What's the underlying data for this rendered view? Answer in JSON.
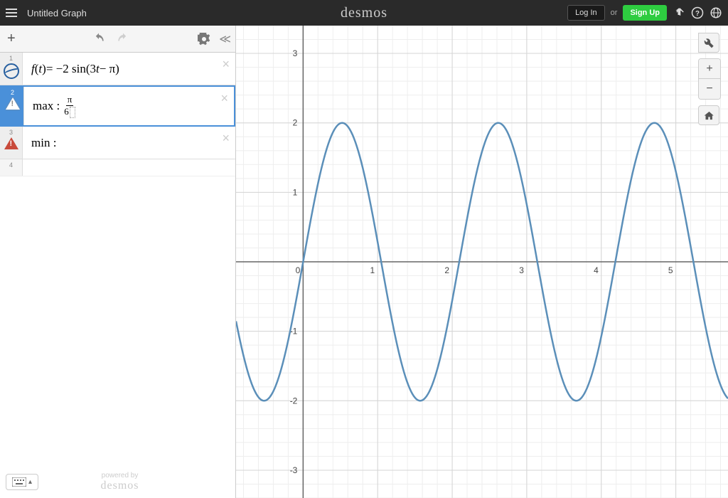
{
  "header": {
    "title": "Untitled Graph",
    "logo": "desmos",
    "login": "Log In",
    "or": "or",
    "signup": "Sign Up"
  },
  "expressions": {
    "row1": {
      "num": "1",
      "formula_prefix": "f",
      "formula_var": "t",
      "formula_eq": " = −2 sin(3",
      "formula_var2": "t",
      "formula_suffix": " − π)"
    },
    "row2": {
      "num": "2",
      "label": "max : ",
      "frac_num": "π",
      "frac_den": "6"
    },
    "row3": {
      "num": "3",
      "label": "min :"
    },
    "row4": {
      "num": "4"
    }
  },
  "footer": {
    "powered_label": "powered by",
    "powered_brand": "desmos"
  },
  "chart_data": {
    "type": "line",
    "title": "",
    "xlabel": "",
    "ylabel": "",
    "xlim": [
      -0.9,
      5.7
    ],
    "ylim": [
      -3.4,
      3.4
    ],
    "xticks": [
      0,
      1,
      2,
      3,
      4,
      5
    ],
    "yticks": [
      -3,
      -2,
      -1,
      1,
      2,
      3
    ],
    "series": [
      {
        "name": "f(t) = -2 sin(3t - π)",
        "formula": "-2*sin(3*t - pi)",
        "amplitude": 2,
        "period": 2.094,
        "phase_shift": 1.047,
        "color": "#5b8fb9"
      }
    ],
    "grid": true
  }
}
